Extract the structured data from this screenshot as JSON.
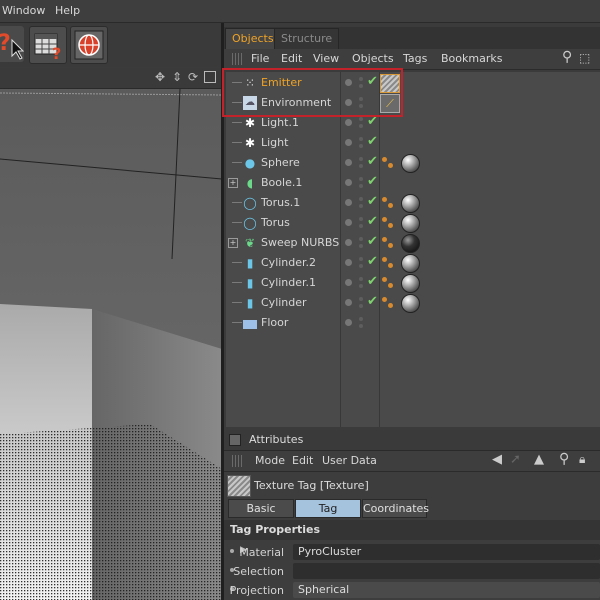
{
  "menubar": {
    "items": [
      "Window",
      "Help"
    ]
  },
  "objects_panel": {
    "tabs": [
      "Objects",
      "Structure"
    ],
    "menu": [
      "File",
      "Edit",
      "View",
      "Objects",
      "Tags",
      "Bookmarks"
    ],
    "rows": [
      {
        "name": "Emitter",
        "icon": "emitter-icon"
      },
      {
        "name": "Environment",
        "icon": "environment-icon"
      },
      {
        "name": "Light.1",
        "icon": "light-icon"
      },
      {
        "name": "Light",
        "icon": "light-icon"
      },
      {
        "name": "Sphere",
        "icon": "sphere-icon"
      },
      {
        "name": "Boole.1",
        "icon": "boole-icon"
      },
      {
        "name": "Torus.1",
        "icon": "torus-icon"
      },
      {
        "name": "Torus",
        "icon": "torus-icon"
      },
      {
        "name": "Sweep NURBS",
        "icon": "sweep-nurbs-icon"
      },
      {
        "name": "Cylinder.2",
        "icon": "cylinder-icon"
      },
      {
        "name": "Cylinder.1",
        "icon": "cylinder-icon"
      },
      {
        "name": "Cylinder",
        "icon": "cylinder-icon"
      },
      {
        "name": "Floor",
        "icon": "floor-icon"
      }
    ]
  },
  "attributes": {
    "title": "Attributes",
    "menu": [
      "Mode",
      "Edit",
      "User Data"
    ],
    "object_label": "Texture Tag [Texture]",
    "tabs": [
      "Basic",
      "Tag",
      "Coordinates"
    ],
    "active_tab": "Tag",
    "section": "Tag Properties",
    "props": [
      {
        "label": "Material",
        "value": "PyroCluster"
      },
      {
        "label": "Selection",
        "value": ""
      },
      {
        "label": "Projection",
        "value": "Spherical"
      }
    ]
  },
  "colors": {
    "active_tab": "#f0a326",
    "highlight_box": "#c4222a",
    "selected_tab": "#a6c3de",
    "check": "#7ed36e"
  }
}
